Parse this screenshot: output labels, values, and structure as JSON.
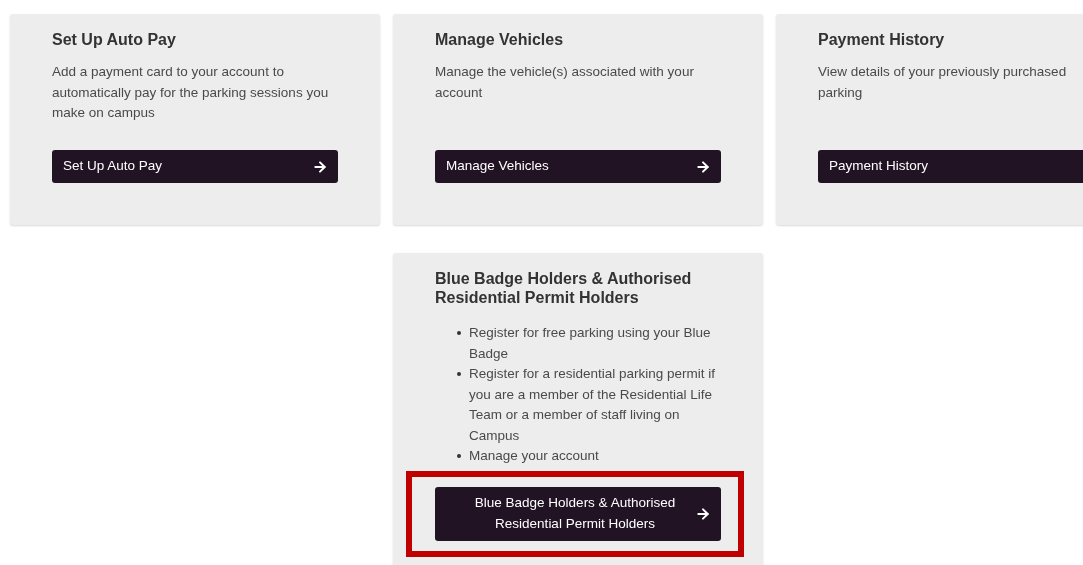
{
  "cards": [
    {
      "title": "Set Up Auto Pay",
      "kind": "text",
      "description": "Add a payment card to your account to automatically pay for the parking sessions you make on campus",
      "button": {
        "label": "Set Up Auto Pay",
        "kind": "single-line",
        "arrow": true,
        "highlighted": false
      }
    },
    {
      "title": "Manage Vehicles",
      "kind": "text",
      "description": "Manage the vehicle(s) associated with your account",
      "button": {
        "label": "Manage Vehicles",
        "kind": "single-line",
        "arrow": true,
        "highlighted": false
      }
    },
    {
      "title": "Payment History",
      "kind": "text",
      "description": "View details of your previously purchased parking",
      "button": {
        "label": "Payment History",
        "kind": "single-line",
        "arrow": false,
        "highlighted": false
      }
    },
    {
      "title": "Blue Badge Holders & Authorised Residential Permit Holders",
      "kind": "list",
      "items": [
        "Register for free parking using your Blue Badge",
        "Register for a residential parking permit if you are a member of the Residential Life Team or a member of staff living on Campus",
        "Manage your account"
      ],
      "button": {
        "label": "Blue Badge Holders & Authorised Residential Permit Holders",
        "kind": "two-line",
        "arrow": true,
        "highlighted": true
      }
    }
  ]
}
